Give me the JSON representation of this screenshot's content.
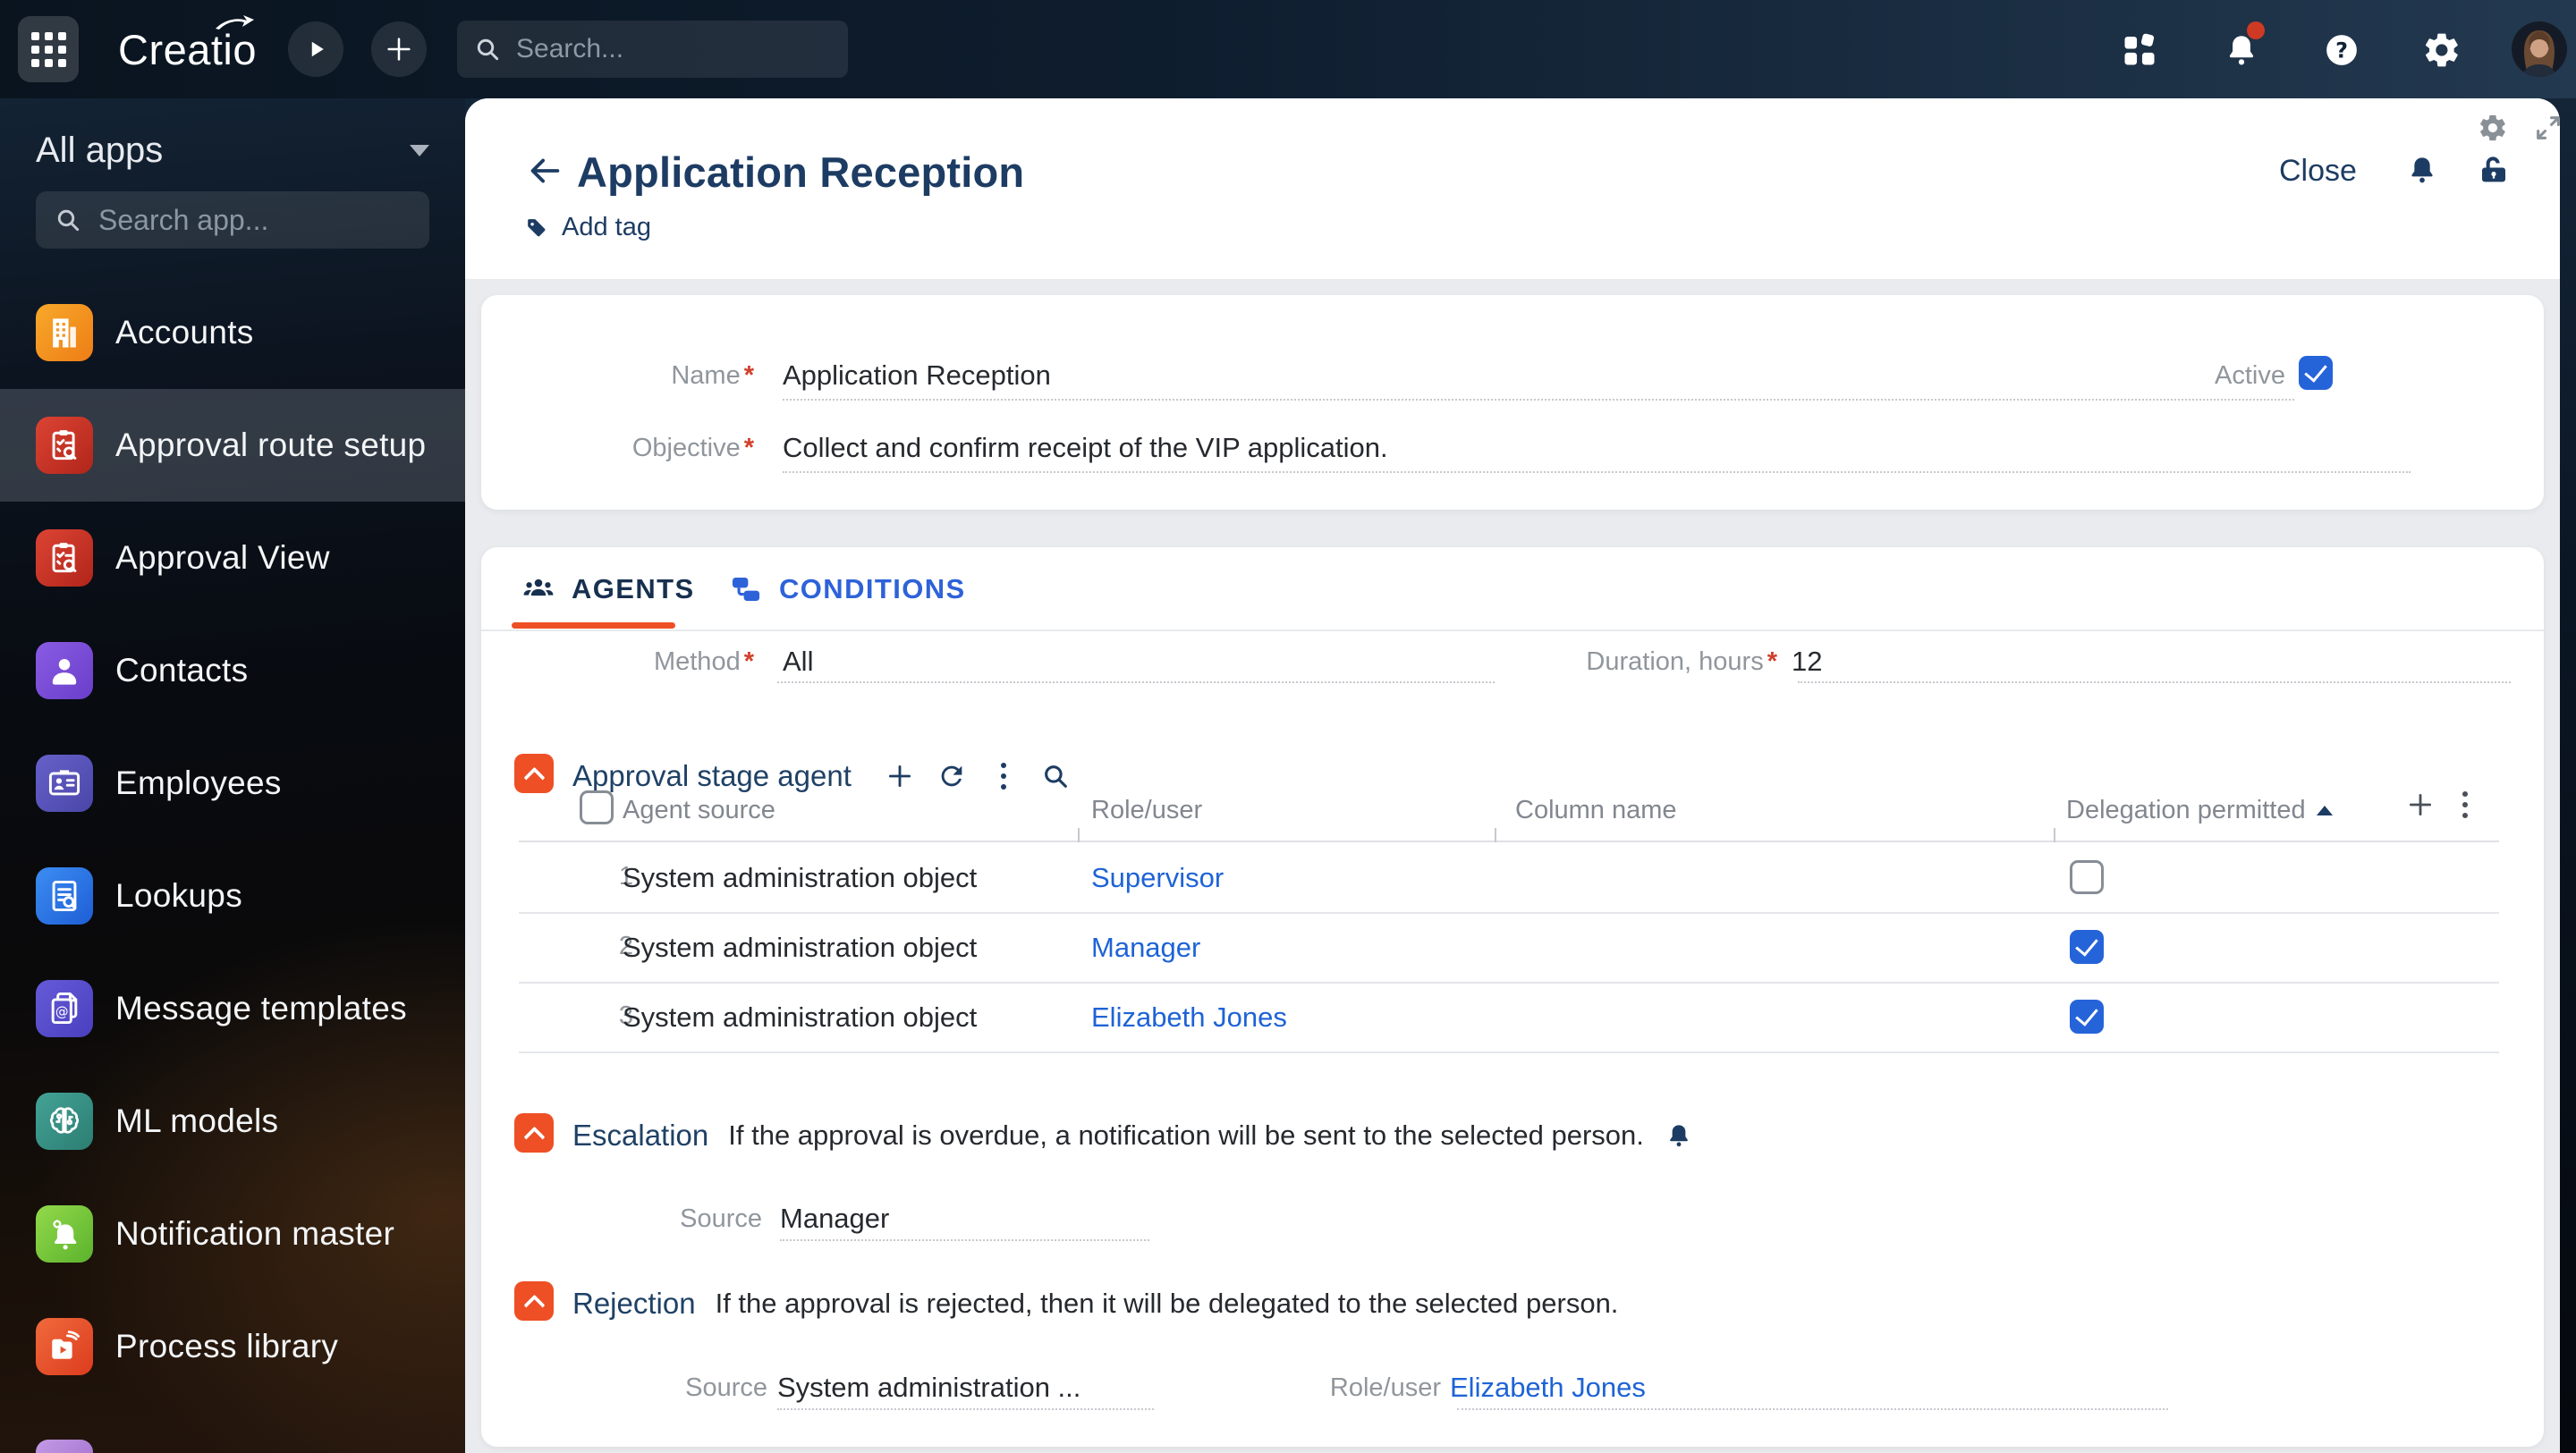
{
  "colors": {
    "accent": "#ee4f25",
    "link": "#1e63d6",
    "checkbox": "#2563d9",
    "navy": "#1d3c63",
    "notification_badge": "#cf3a24"
  },
  "topbar": {
    "logo": "Creatio",
    "search": {
      "placeholder": "Search..."
    }
  },
  "sidebar": {
    "all_apps": "All apps",
    "search": {
      "placeholder": "Search app..."
    },
    "items": [
      {
        "label": "Accounts",
        "icon": "building",
        "colors": [
          "#f7a92b",
          "#ee7d15"
        ],
        "selected": false
      },
      {
        "label": "Approval route setup",
        "icon": "approval",
        "colors": [
          "#dc4434",
          "#b1251a"
        ],
        "selected": true
      },
      {
        "label": "Approval View",
        "icon": "approval",
        "colors": [
          "#dc4434",
          "#b1251a"
        ],
        "selected": false
      },
      {
        "label": "Contacts",
        "icon": "person",
        "colors": [
          "#8a5ce4",
          "#6a3ec9"
        ],
        "selected": false
      },
      {
        "label": "Employees",
        "icon": "idcard",
        "colors": [
          "#6661c9",
          "#4a46a8"
        ],
        "selected": false
      },
      {
        "label": "Lookups",
        "icon": "lookup",
        "colors": [
          "#3c8df2",
          "#1e5ed6"
        ],
        "selected": false
      },
      {
        "label": "Message templates",
        "icon": "template",
        "colors": [
          "#655bd8",
          "#4a3fbe"
        ],
        "selected": false
      },
      {
        "label": "ML models",
        "icon": "brain",
        "colors": [
          "#43a395",
          "#2c7d72"
        ],
        "selected": false
      },
      {
        "label": "Notification master",
        "icon": "bellgear",
        "colors": [
          "#93d94c",
          "#5bb32c"
        ],
        "selected": false
      },
      {
        "label": "Process library",
        "icon": "process",
        "colors": [
          "#f06a3c",
          "#dc3c1e"
        ],
        "selected": false
      }
    ]
  },
  "page": {
    "title": "Application Reception",
    "close": "Close",
    "add_tag": "Add tag",
    "form": {
      "name": {
        "label": "Name",
        "required": true,
        "value": "Application Reception"
      },
      "active": {
        "label": "Active",
        "checked": true
      },
      "objective": {
        "label": "Objective",
        "required": true,
        "value": "Collect and confirm receipt of the VIP application."
      }
    },
    "tabs": [
      {
        "label": "AGENTS",
        "active": true
      },
      {
        "label": "CONDITIONS",
        "active": false
      }
    ],
    "agents_tab": {
      "method": {
        "label": "Method",
        "required": true,
        "value": "All"
      },
      "duration": {
        "label": "Duration, hours",
        "required": true,
        "value": "12"
      },
      "stage_agent": {
        "title": "Approval stage agent",
        "columns": {
          "agent_source": "Agent source",
          "role_user": "Role/user",
          "column_name": "Column name",
          "delegation": "Delegation permitted"
        },
        "sort": {
          "column": "Delegation permitted",
          "direction": "asc"
        },
        "rows": [
          {
            "num": "1",
            "agent_source": "System administration object",
            "role_user": "Supervisor",
            "column_name": "",
            "delegation_permitted": false
          },
          {
            "num": "2",
            "agent_source": "System administration object",
            "role_user": "Manager",
            "column_name": "",
            "delegation_permitted": true
          },
          {
            "num": "3",
            "agent_source": "System administration object",
            "role_user": "Elizabeth Jones",
            "column_name": "",
            "delegation_permitted": true
          }
        ]
      },
      "escalation": {
        "title": "Escalation",
        "description": "If the approval is overdue, a notification will be sent to the selected person.",
        "source": {
          "label": "Source",
          "value": "Manager"
        }
      },
      "rejection": {
        "title": "Rejection",
        "description": "If the approval is rejected, then it will be delegated to the selected person.",
        "source": {
          "label": "Source",
          "value": "System administration ..."
        },
        "role_user": {
          "label": "Role/user",
          "value": "Elizabeth Jones"
        }
      }
    }
  }
}
